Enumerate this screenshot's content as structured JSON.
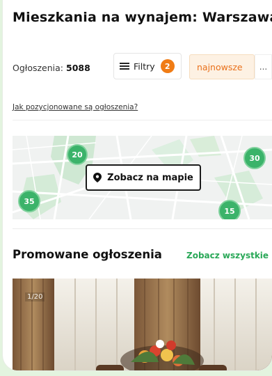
{
  "header": {
    "title": "Mieszkania na wynajem: Warszawa"
  },
  "toolbar": {
    "count_label": "Ogłoszenia:",
    "count_value": "5088",
    "filters_label": "Filtry",
    "filters_badge": "2",
    "sort_label": "najnowsze",
    "more_label": "..."
  },
  "info_link": "Jak pozycjonowane są ogłoszenia?",
  "map": {
    "button_label": "Zobacz na mapie",
    "clusters": [
      "20",
      "30",
      "35",
      "15"
    ]
  },
  "promoted": {
    "title": "Promowane ogłoszenia",
    "see_all": "Zobacz wszystkie",
    "photo_counter": "1/20"
  },
  "colors": {
    "accent_green": "#2aa858",
    "accent_orange": "#e9701a",
    "badge_orange": "#f07c15",
    "page_background": "#e3f4df"
  }
}
